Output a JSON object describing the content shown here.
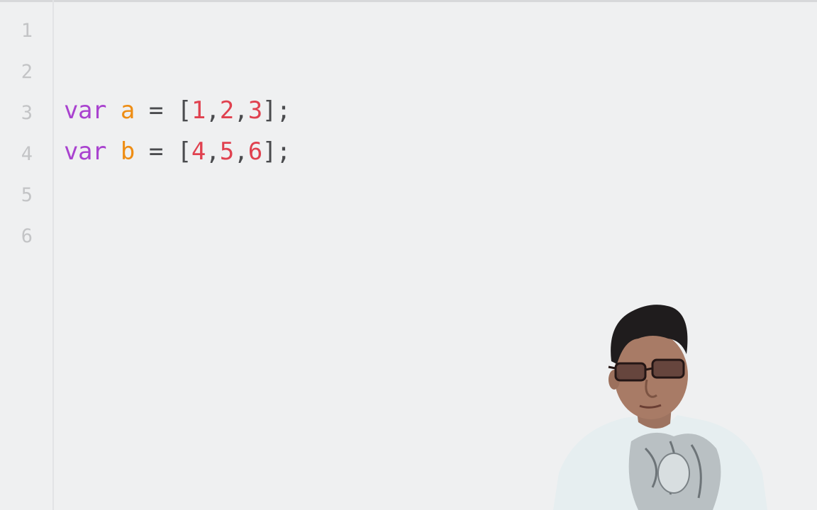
{
  "editor": {
    "line_numbers": [
      "1",
      "2",
      "3",
      "4",
      "5",
      "6"
    ],
    "lines": [
      {
        "kw": "var",
        "sp1": " ",
        "id": "a",
        "sp2": " ",
        "op": "=",
        "sp3": " ",
        "open": "[",
        "n1": "1",
        "c1": ",",
        "n2": "2",
        "c2": ",",
        "n3": "3",
        "close": "];"
      },
      {
        "kw": "var",
        "sp1": " ",
        "id": "b",
        "sp2": " ",
        "op": "=",
        "sp3": " ",
        "open": "[",
        "n1": "4",
        "c1": ",",
        "n2": "5",
        "c2": ",",
        "n3": "6",
        "close": "];"
      }
    ]
  },
  "colors": {
    "background": "#eff0f1",
    "keyword": "#a942cf",
    "identifier": "#ee8d14",
    "number": "#e0414f",
    "punctuation": "#4a4b4e",
    "line_number": "#c3c4c6"
  },
  "overlay": {
    "icon": "presenter-webcam"
  }
}
